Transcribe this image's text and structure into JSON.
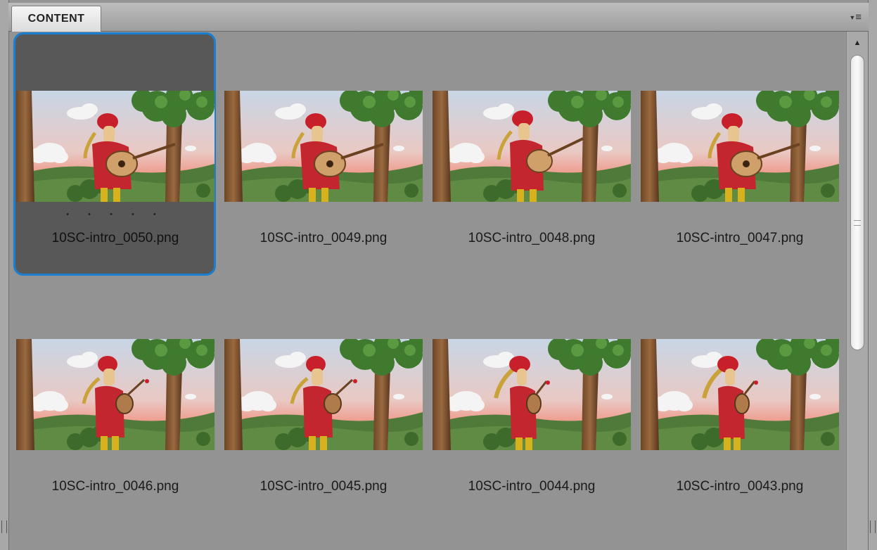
{
  "panel": {
    "tab_label": "CONTENT",
    "menu_icon": "panel-menu-icon"
  },
  "colors": {
    "selection_border": "#1a7fd1",
    "selection_fill": "#585858",
    "panel_bg": "#939393"
  },
  "items": [
    {
      "label": "10SC-intro_0050.png",
      "selected": true,
      "rating_dots": "• • • • •"
    },
    {
      "label": "10SC-intro_0049.png",
      "selected": false
    },
    {
      "label": "10SC-intro_0048.png",
      "selected": false
    },
    {
      "label": "10SC-intro_0047.png",
      "selected": false
    },
    {
      "label": "10SC-intro_0046.png",
      "selected": false
    },
    {
      "label": "10SC-intro_0045.png",
      "selected": false
    },
    {
      "label": "10SC-intro_0044.png",
      "selected": false
    },
    {
      "label": "10SC-intro_0043.png",
      "selected": false
    }
  ],
  "scrollbar": {
    "up_icon": "scroll-up-arrow-icon"
  }
}
